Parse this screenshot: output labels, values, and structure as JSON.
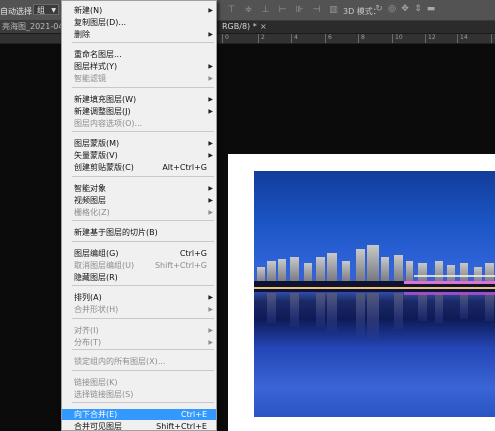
{
  "options_bar": {
    "auto_select_label": "自动选择：",
    "auto_select_value": "组",
    "mode_3d_label": "3D 模式："
  },
  "tabs": {
    "doc_tab_label": "亮海图_2021-04-25-0",
    "doc_tab_mode": "RGB/8) *",
    "close_glyph": "×"
  },
  "ruler": {
    "ticks": [
      "0",
      "2",
      "4",
      "6",
      "8",
      "10",
      "12",
      "14",
      "16"
    ]
  },
  "menu": {
    "items": [
      {
        "label": "新建(N)",
        "shortcut": "",
        "submenu": true,
        "disabled": false
      },
      {
        "label": "复制图层(D)...",
        "shortcut": "",
        "submenu": false,
        "disabled": false
      },
      {
        "label": "删除",
        "shortcut": "",
        "submenu": true,
        "disabled": false
      },
      {
        "label": "重命名图层...",
        "shortcut": "",
        "submenu": false,
        "disabled": false
      },
      {
        "label": "图层样式(Y)",
        "shortcut": "",
        "submenu": true,
        "disabled": false
      },
      {
        "label": "智能滤镜",
        "shortcut": "",
        "submenu": true,
        "disabled": true
      },
      {
        "label": "新建填充图层(W)",
        "shortcut": "",
        "submenu": true,
        "disabled": false
      },
      {
        "label": "新建调整图层(J)",
        "shortcut": "",
        "submenu": true,
        "disabled": false
      },
      {
        "label": "图层内容选项(O)...",
        "shortcut": "",
        "submenu": false,
        "disabled": true
      },
      {
        "label": "图层蒙版(M)",
        "shortcut": "",
        "submenu": true,
        "disabled": false
      },
      {
        "label": "矢量蒙版(V)",
        "shortcut": "",
        "submenu": true,
        "disabled": false
      },
      {
        "label": "创建剪贴蒙版(C)",
        "shortcut": "Alt+Ctrl+G",
        "submenu": false,
        "disabled": false
      },
      {
        "label": "智能对象",
        "shortcut": "",
        "submenu": true,
        "disabled": false
      },
      {
        "label": "视频图层",
        "shortcut": "",
        "submenu": true,
        "disabled": false
      },
      {
        "label": "栅格化(Z)",
        "shortcut": "",
        "submenu": true,
        "disabled": true
      },
      {
        "label": "新建基于图层的切片(B)",
        "shortcut": "",
        "submenu": false,
        "disabled": false
      },
      {
        "label": "图层编组(G)",
        "shortcut": "Ctrl+G",
        "submenu": false,
        "disabled": false
      },
      {
        "label": "取消图层编组(U)",
        "shortcut": "Shift+Ctrl+G",
        "submenu": false,
        "disabled": true
      },
      {
        "label": "隐藏图层(R)",
        "shortcut": "",
        "submenu": false,
        "disabled": false
      },
      {
        "label": "排列(A)",
        "shortcut": "",
        "submenu": true,
        "disabled": false
      },
      {
        "label": "合并形状(H)",
        "shortcut": "",
        "submenu": true,
        "disabled": true
      },
      {
        "label": "对齐(I)",
        "shortcut": "",
        "submenu": true,
        "disabled": true
      },
      {
        "label": "分布(T)",
        "shortcut": "",
        "submenu": true,
        "disabled": true
      },
      {
        "label": "锁定组内的所有图层(X)...",
        "shortcut": "",
        "submenu": false,
        "disabled": true
      },
      {
        "label": "链接图层(K)",
        "shortcut": "",
        "submenu": false,
        "disabled": true
      },
      {
        "label": "选择链接图层(S)",
        "shortcut": "",
        "submenu": false,
        "disabled": true
      },
      {
        "label": "向下合并(E)",
        "shortcut": "Ctrl+E",
        "submenu": false,
        "disabled": false,
        "selected": true
      },
      {
        "label": "合并可见图层",
        "shortcut": "Shift+Ctrl+E",
        "submenu": false,
        "disabled": false
      }
    ]
  },
  "colors": {
    "menu_bg": "#f0f0f0",
    "menu_highlight": "#3399ff",
    "workspace_bg": "#0b0b0b",
    "photo_sky": "#1c56c6"
  }
}
